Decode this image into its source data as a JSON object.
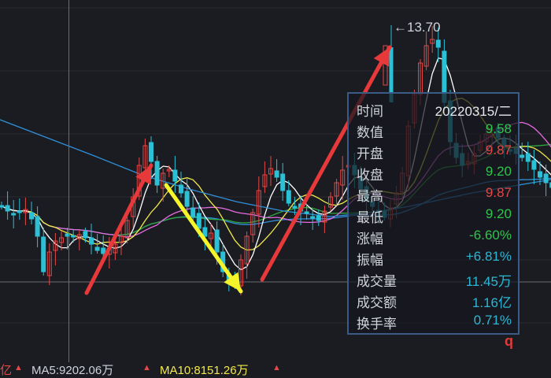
{
  "price_tag": "←13.70",
  "tooltip": {
    "rows": [
      {
        "label": "时间",
        "value": "20220315/二",
        "color": "#e6e8ec"
      },
      {
        "label": "数值",
        "value": "9.58",
        "color": "#2fc44d"
      },
      {
        "label": "开盘",
        "value": "9.87",
        "color": "#e24848"
      },
      {
        "label": "收盘",
        "value": "9.20",
        "color": "#2fc44d"
      },
      {
        "label": "最高",
        "value": "9.87",
        "color": "#e24848"
      },
      {
        "label": "最低",
        "value": "9.20",
        "color": "#2fc44d"
      },
      {
        "label": "涨幅",
        "value": "-6.60%",
        "color": "#2fc44d"
      },
      {
        "label": "振幅",
        "value": "+6.81%",
        "color": "#2bb7d6"
      },
      {
        "label": "成交量",
        "value": "11.45万",
        "color": "#2bb7d6"
      },
      {
        "label": "成交额",
        "value": "1.16亿",
        "color": "#2bb7d6"
      },
      {
        "label": "换手率",
        "value": "0.71%",
        "color": "#2bb7d6"
      }
    ]
  },
  "q_label": "q",
  "bottom_bar": {
    "left_fragment": "亿",
    "ma5": "MA5:9202.06万",
    "ma10": "MA10:8151.26万",
    "ma5_color": "#cfd3da",
    "ma10_color": "#f2e84a"
  },
  "colors": {
    "up": "#e24848",
    "down": "#2bc0d6",
    "ma5": "#ffffff",
    "ma10": "#f2e84a",
    "ma20": "#e86ae0",
    "ma30": "#2fa83f",
    "ma60": "#2f8fd8",
    "arrow_red": "#e8393a",
    "arrow_yellow": "#f5f52a"
  }
}
